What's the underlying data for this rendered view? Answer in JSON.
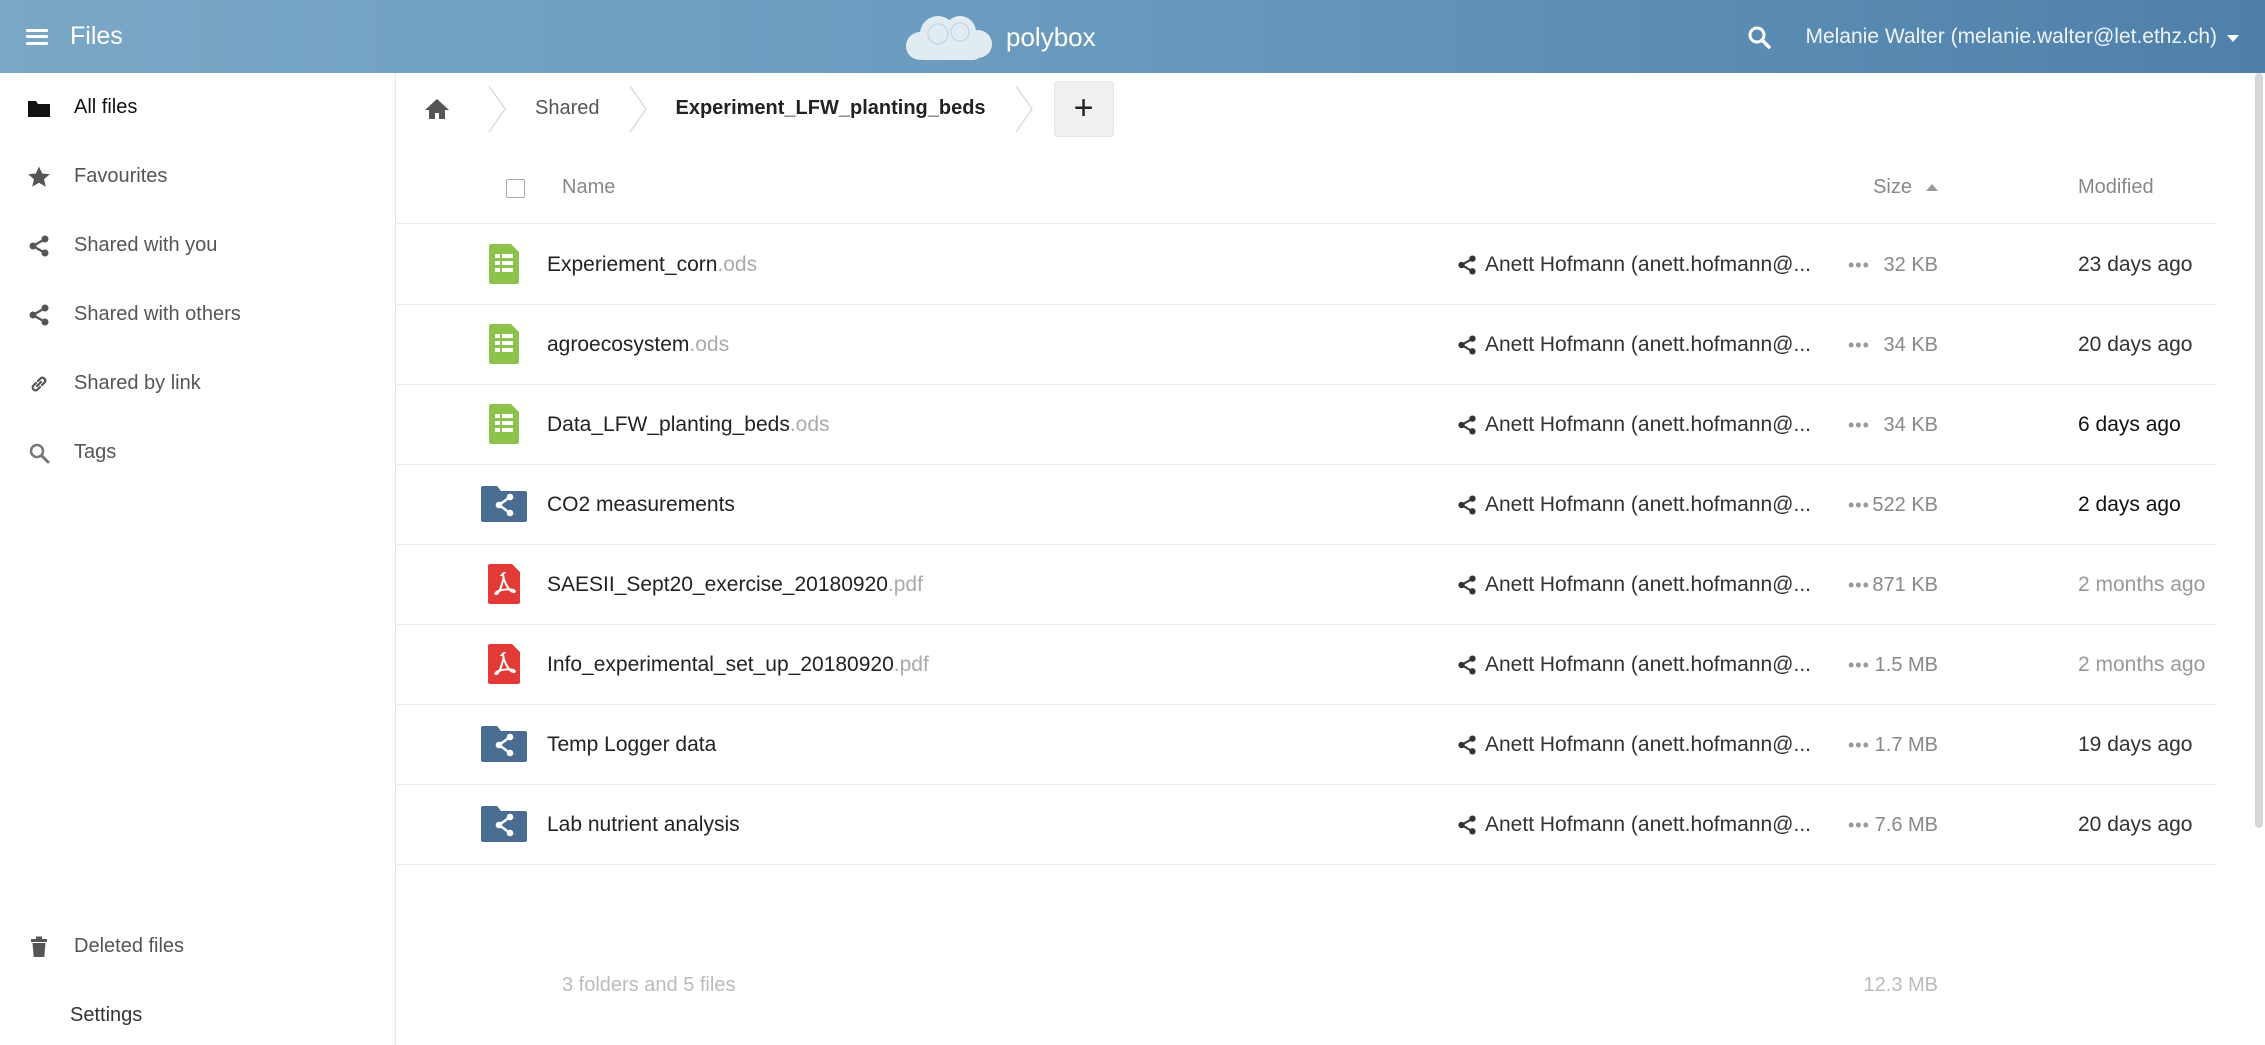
{
  "header": {
    "app_title": "Files",
    "logo_text": "polybox",
    "user": "Melanie Walter (melanie.walter@let.ethz.ch)",
    "colors": {
      "gradient_start": "#7ba7c6",
      "gradient_end": "#4f80aa"
    }
  },
  "sidebar": {
    "items": [
      {
        "label": "All files",
        "icon": "folder-icon",
        "active": true
      },
      {
        "label": "Favourites",
        "icon": "star-icon"
      },
      {
        "label": "Shared with you",
        "icon": "share-icon"
      },
      {
        "label": "Shared with others",
        "icon": "share-icon"
      },
      {
        "label": "Shared by link",
        "icon": "link-icon"
      },
      {
        "label": "Tags",
        "icon": "search-icon"
      }
    ],
    "deleted_files": "Deleted files",
    "settings": "Settings"
  },
  "breadcrumb": {
    "items": [
      "Shared",
      "Experiment_LFW_planting_beds"
    ],
    "add_label": "+"
  },
  "table": {
    "headers": {
      "name": "Name",
      "size": "Size",
      "modified": "Modified"
    },
    "files": [
      {
        "name": "Experiement_corn",
        "ext": ".ods",
        "type": "spreadsheet",
        "shared_by": "Anett Hofmann (anett.hofmann@...",
        "more": "•••",
        "size": "32 KB",
        "modified": "23 days ago",
        "mod_color": "#333"
      },
      {
        "name": "agroecosystem",
        "ext": ".ods",
        "type": "spreadsheet",
        "shared_by": "Anett Hofmann (anett.hofmann@...",
        "more": "•••",
        "size": "34 KB",
        "modified": "20 days ago",
        "mod_color": "#333"
      },
      {
        "name": "Data_LFW_planting_beds",
        "ext": ".ods",
        "type": "spreadsheet",
        "shared_by": "Anett Hofmann (anett.hofmann@...",
        "more": "•••",
        "size": "34 KB",
        "modified": "6 days ago",
        "mod_color": "#111"
      },
      {
        "name": "CO2 measurements",
        "ext": "",
        "type": "shared-folder",
        "shared_by": "Anett Hofmann (anett.hofmann@...",
        "more": "•••",
        "size": "522 KB",
        "modified": "2 days ago",
        "mod_color": "#111"
      },
      {
        "name": "SAESII_Sept20_exercise_20180920",
        "ext": ".pdf",
        "type": "pdf",
        "shared_by": "Anett Hofmann (anett.hofmann@...",
        "more": "•••",
        "size": "871 KB",
        "modified": "2 months ago",
        "mod_color": "#999"
      },
      {
        "name": "Info_experimental_set_up_20180920",
        "ext": ".pdf",
        "type": "pdf",
        "shared_by": "Anett Hofmann (anett.hofmann@...",
        "more": "•••",
        "size": "1.5 MB",
        "modified": "2 months ago",
        "mod_color": "#999"
      },
      {
        "name": "Temp Logger data",
        "ext": "",
        "type": "shared-folder",
        "shared_by": "Anett Hofmann (anett.hofmann@...",
        "more": "•••",
        "size": "1.7 MB",
        "modified": "19 days ago",
        "mod_color": "#333"
      },
      {
        "name": "Lab nutrient analysis",
        "ext": "",
        "type": "shared-folder",
        "shared_by": "Anett Hofmann (anett.hofmann@...",
        "more": "•••",
        "size": "7.6 MB",
        "modified": "20 days ago",
        "mod_color": "#333"
      }
    ],
    "summary": {
      "text": "3 folders and 5 files",
      "size": "12.3 MB"
    }
  }
}
